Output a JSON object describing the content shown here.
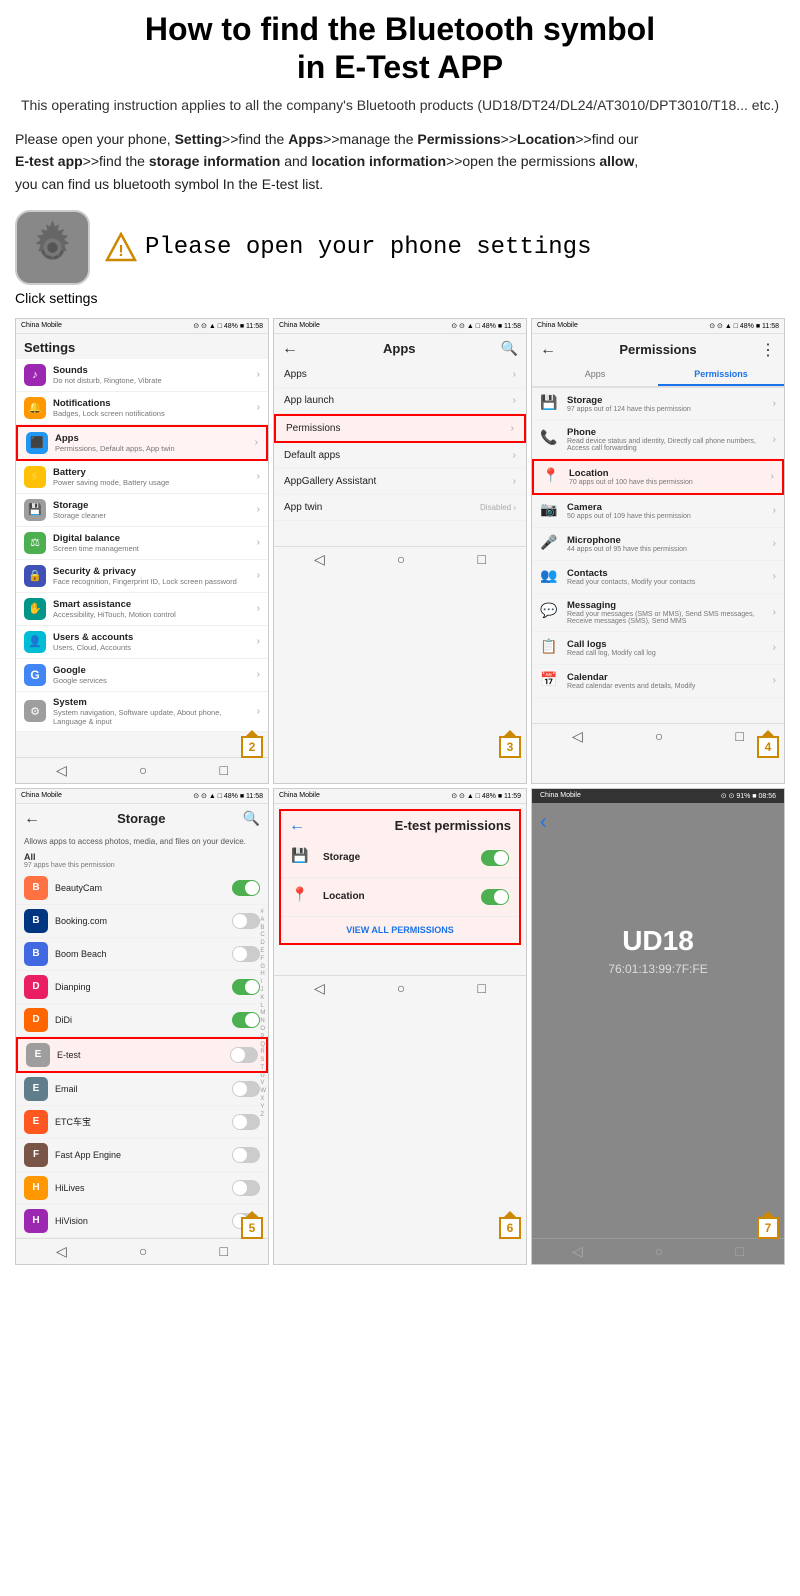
{
  "header": {
    "title_line1": "How to find the Bluetooth symbol",
    "title_line2": "in E-Test APP",
    "subtitle": "This operating instruction applies to all the company's Bluetooth products\n(UD18/DT24/DL24/AT3010/DPT3010/T18... etc.)"
  },
  "instructions": {
    "text1": "Please open your phone, ",
    "bold1": "Setting",
    "text2": ">>find the ",
    "bold2": "Apps",
    "text3": ">>manage the ",
    "bold3": "Permissions",
    "text4": ">>",
    "bold4": "Location",
    "text5": ">>find our\n",
    "bold5": "E-test app",
    "text6": ">>find the ",
    "bold6": "storage information",
    "text7": " and ",
    "bold7": "location information",
    "text8": ">>open the permissions ",
    "bold8": "allow",
    "text9": ",\nyou can find us bluetooth symbol In the E-test list."
  },
  "open_settings_label": "Please open your phone settings",
  "click_settings": "Click settings",
  "screen1": {
    "carrier": "China Mobile",
    "time": "11:58",
    "title": "Settings",
    "items": [
      {
        "icon_color": "purple",
        "icon": "♪",
        "label": "Sounds",
        "sub": "Do not disturb, Ringtone, Vibrate",
        "highlighted": false
      },
      {
        "icon_color": "orange",
        "icon": "🔔",
        "label": "Notifications",
        "sub": "Badges, Lock screen notifications",
        "highlighted": false
      },
      {
        "icon_color": "blue",
        "icon": "⬛",
        "label": "Apps",
        "sub": "Permissions, Default apps, App twin",
        "highlighted": true
      },
      {
        "icon_color": "yellow",
        "icon": "⚡",
        "label": "Battery",
        "sub": "Power saving mode, Battery usage",
        "highlighted": false
      },
      {
        "icon_color": "gray",
        "icon": "💾",
        "label": "Storage",
        "sub": "Storage cleaner",
        "highlighted": false
      },
      {
        "icon_color": "green",
        "icon": "⚖",
        "label": "Digital balance",
        "sub": "Screen time management",
        "highlighted": false
      },
      {
        "icon_color": "indigo",
        "icon": "🔒",
        "label": "Security & privacy",
        "sub": "Face recognition, Fingerprint ID, Lock screen password",
        "highlighted": false
      },
      {
        "icon_color": "teal",
        "icon": "✋",
        "label": "Smart assistance",
        "sub": "Accessibility, HiTouch, Motion control",
        "highlighted": false
      },
      {
        "icon_color": "cyan",
        "icon": "👤",
        "label": "Users & accounts",
        "sub": "Users, Cloud, Accounts",
        "highlighted": false
      },
      {
        "icon_color": "red",
        "icon": "G",
        "label": "Google",
        "sub": "Google services",
        "highlighted": false
      },
      {
        "icon_color": "gray",
        "icon": "⚙",
        "label": "System",
        "sub": "System navigation, Software update, About phone, Language & input",
        "highlighted": false
      }
    ],
    "step": "2"
  },
  "screen2": {
    "carrier": "China Mobile",
    "time": "11:58",
    "title": "Apps",
    "items": [
      {
        "label": "Apps",
        "highlighted": false
      },
      {
        "label": "App launch",
        "highlighted": false
      },
      {
        "label": "Permissions",
        "highlighted": true
      },
      {
        "label": "Default apps",
        "highlighted": false
      },
      {
        "label": "AppGallery Assistant",
        "highlighted": false
      },
      {
        "label": "App twin",
        "value": "Disabled",
        "highlighted": false
      }
    ],
    "step": "3"
  },
  "screen3": {
    "carrier": "China Mobile",
    "time": "11:58",
    "title": "Permissions",
    "tabs": [
      "Apps",
      "Permissions"
    ],
    "active_tab": "Permissions",
    "items": [
      {
        "icon": "💾",
        "label": "Storage",
        "sub": "97 apps out of 124 have this permission",
        "highlighted": false
      },
      {
        "icon": "📞",
        "label": "Phone",
        "sub": "Read device status and identity, Directly call phone numbers, Access call forwarding",
        "highlighted": false
      },
      {
        "icon": "📍",
        "label": "Location",
        "sub": "70 apps out of 100 have this permission",
        "highlighted": true
      },
      {
        "icon": "📷",
        "label": "Camera",
        "sub": "50 apps out of 109 have this permission",
        "highlighted": false
      },
      {
        "icon": "🎤",
        "label": "Microphone",
        "sub": "44 apps out of 95 have this permission",
        "highlighted": false
      },
      {
        "icon": "👥",
        "label": "Contacts",
        "sub": "Read your contacts, Modify your contacts",
        "highlighted": false
      },
      {
        "icon": "💬",
        "label": "Messaging",
        "sub": "Read your messages (SMS or MMS), Send SMS messages, Receive messages (SMS), Send MMS",
        "highlighted": false
      },
      {
        "icon": "📋",
        "label": "Call logs",
        "sub": "Read call log, Modify call log",
        "highlighted": false
      },
      {
        "icon": "📅",
        "label": "Calendar",
        "sub": "Read calendar events and details, Modify",
        "highlighted": false
      }
    ],
    "step": "4"
  },
  "screen4": {
    "carrier": "China Mobile",
    "time": "11:58",
    "title": "Storage",
    "desc": "Allows apps to access photos, media, and files on your device.",
    "all_header": "All",
    "all_count": "97 apps have this permission",
    "apps": [
      {
        "name": "BeautyCam",
        "color": "#ff7043",
        "letter": "B",
        "on": true
      },
      {
        "name": "Booking.com",
        "color": "#003580",
        "letter": "B",
        "on": false
      },
      {
        "name": "Boom Beach",
        "color": "#4169e1",
        "letter": "B",
        "on": false
      },
      {
        "name": "Dianping",
        "color": "#e91e63",
        "letter": "D",
        "on": true
      },
      {
        "name": "DiDi",
        "color": "#ff6600",
        "letter": "D",
        "on": true
      },
      {
        "name": "E-test",
        "color": "#9e9e9e",
        "letter": "E",
        "on": false,
        "highlighted": true
      },
      {
        "name": "Email",
        "color": "#607d8b",
        "letter": "E",
        "on": false
      },
      {
        "name": "ETC车宝",
        "color": "#ff5722",
        "letter": "E",
        "on": false
      },
      {
        "name": "Fast App Engine",
        "color": "#795548",
        "letter": "F",
        "on": false
      },
      {
        "name": "HiLives",
        "color": "#ff9800",
        "letter": "H",
        "on": false
      },
      {
        "name": "HiVision",
        "color": "#9c27b0",
        "letter": "H",
        "on": false
      }
    ],
    "alphabet": [
      "#",
      "A",
      "B",
      "C",
      "D",
      "E",
      "F",
      "G",
      "H",
      "I",
      "J",
      "K",
      "L",
      "M",
      "N",
      "O",
      "P",
      "Q",
      "R",
      "S",
      "T",
      "U",
      "V",
      "W",
      "X",
      "Y",
      "Z"
    ],
    "step": "5"
  },
  "screen5": {
    "carrier": "China Mobile",
    "time": "11:59",
    "title": "E-test permissions",
    "items": [
      {
        "icon": "💾",
        "label": "Storage",
        "on": true
      },
      {
        "icon": "📍",
        "label": "Location",
        "on": true
      }
    ],
    "view_all": "VIEW ALL PERMISSIONS",
    "step": "6"
  },
  "screen6": {
    "carrier": "China Mobile",
    "time": "08:56",
    "battery": "91%",
    "title": "UD18",
    "subtitle": "76:01:13:99:7F:FE",
    "step": "7"
  }
}
